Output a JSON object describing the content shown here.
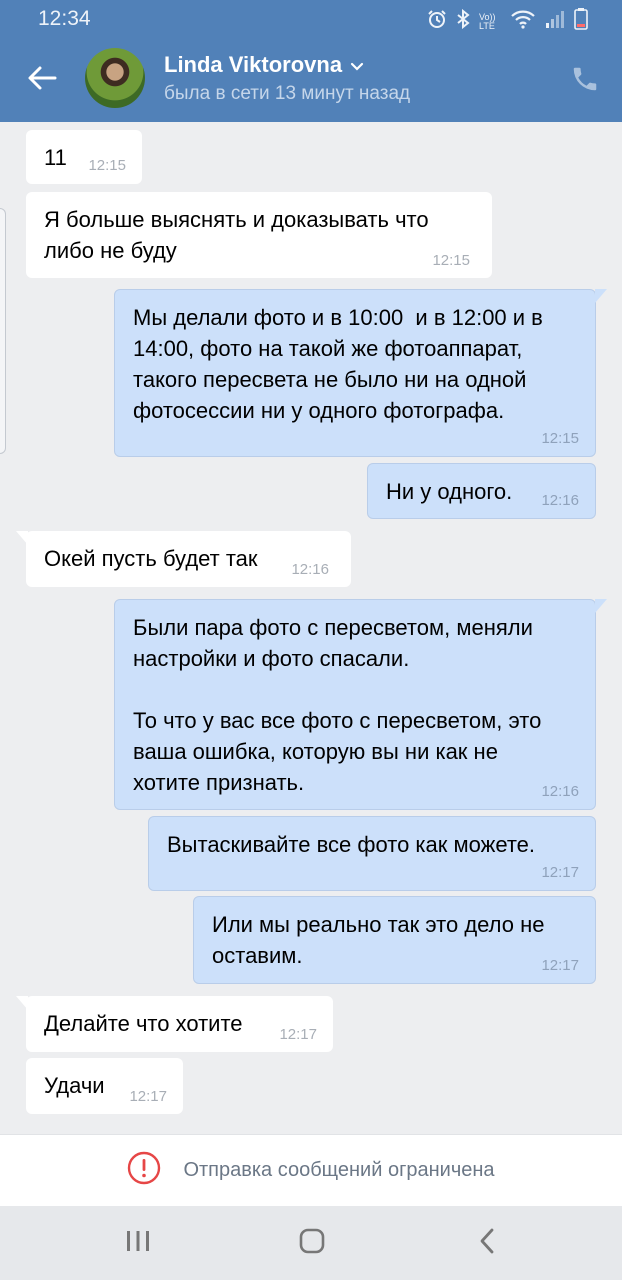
{
  "status_bar": {
    "time": "12:34",
    "volte_label": "Vo)) LTE",
    "icons": [
      "alarm-icon",
      "bluetooth-icon",
      "volte-icon",
      "wifi-icon",
      "signal-icon",
      "battery-low-icon"
    ]
  },
  "header": {
    "back_icon": "arrow-left-icon",
    "contact_name": "Linda Viktorovna",
    "status": "была в сети 13 минут назад",
    "call_icon": "phone-icon",
    "colors": {
      "bar": "#5181b8"
    }
  },
  "messages": [
    {
      "direction": "in",
      "text": "11",
      "time": "12:15"
    },
    {
      "direction": "in",
      "text": "Я больше выяснять и доказывать что\nлибо не буду",
      "time": "12:15"
    },
    {
      "direction": "out",
      "text": "Мы делали фото и в 10:00  и в 12:00 и в\n14:00, фото на такой же фотоаппарат,\nтакого пересвета не было ни на одной\nфотосессии ни у одного фотографа.",
      "time": "12:15"
    },
    {
      "direction": "out",
      "text": "Ни у одного.",
      "time": "12:16"
    },
    {
      "direction": "in",
      "text": "Окей пусть будет так",
      "time": "12:16"
    },
    {
      "direction": "out",
      "text": "Были пара фото с пересветом, меняли\nнастройки и фото спасали.\n\nТо что у вас все фото с пересветом, это\nваша ошибка, которую вы ни как не\nхотите признать.",
      "time": "12:16"
    },
    {
      "direction": "out",
      "text": "Вытаскивайте все фото как можете.",
      "time": "12:17"
    },
    {
      "direction": "out",
      "text": "Или мы реально так это дело не\nоставим.",
      "time": "12:17"
    },
    {
      "direction": "in",
      "text": "Делайте что хотите",
      "time": "12:17"
    },
    {
      "direction": "in",
      "text": "Удачи",
      "time": "12:17"
    }
  ],
  "notice": {
    "icon": "error-circle-icon",
    "text": "Отправка сообщений ограничена",
    "color": "#e64646"
  },
  "nav_bar": {
    "items": [
      "recent-apps-icon",
      "home-icon",
      "back-icon"
    ]
  }
}
